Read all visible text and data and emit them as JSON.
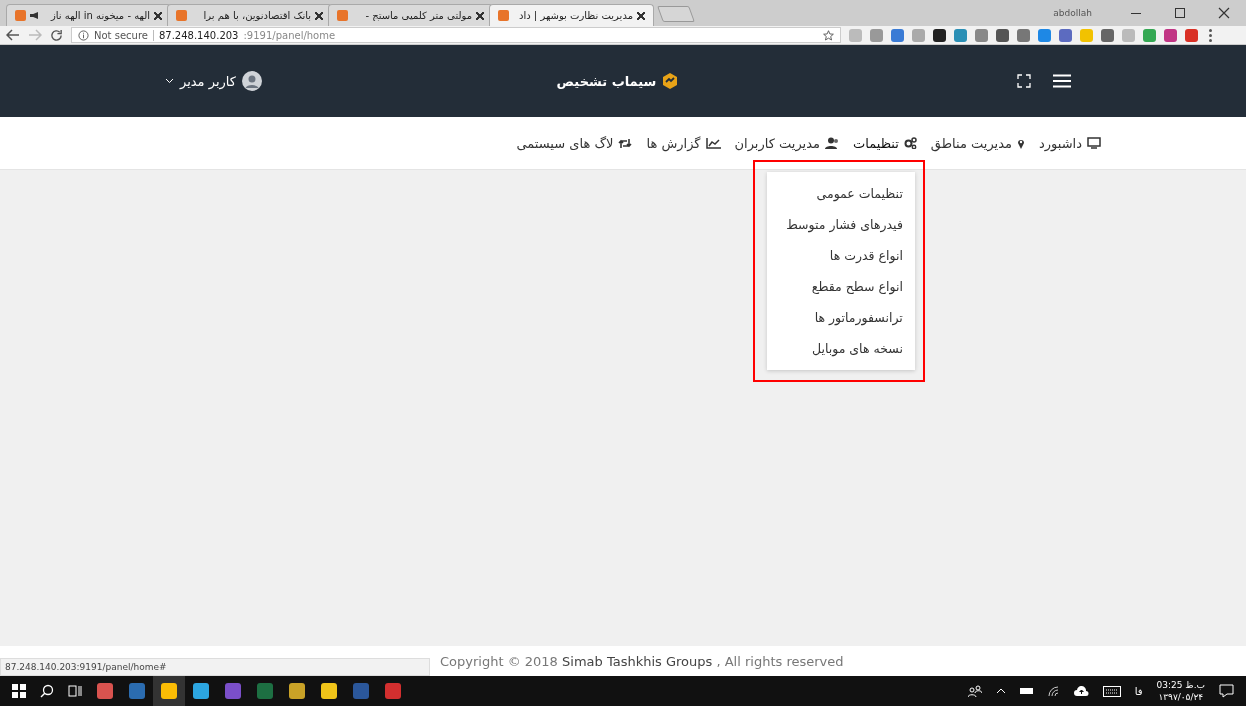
{
  "browser": {
    "tabs": [
      {
        "title": "مدیریت نظارت بوشهر | داد",
        "selected": true,
        "audio": false
      },
      {
        "title": "مولتی متر کلمپی ماستج -",
        "selected": false,
        "audio": false
      },
      {
        "title": "بانک اقتصادنوین، با هم برا",
        "selected": false,
        "audio": false
      },
      {
        "title": "الهه - میخونه in الهه ناز",
        "selected": false,
        "audio": true
      }
    ],
    "profile": "abdollah",
    "security": "Not secure",
    "url_host": "87.248.140.203",
    "url_rest": ":9191/panel/home"
  },
  "header": {
    "user": "کاربر مدیر",
    "brand": "سیماب تشخیص"
  },
  "nav": [
    {
      "label": "داشبورد",
      "kind": "monitor",
      "expanded": false
    },
    {
      "label": "مدیریت مناطق",
      "kind": "pin",
      "expanded": false
    },
    {
      "label": "تنظیمات",
      "kind": "gears",
      "expanded": true,
      "menu": [
        "تنظیمات عمومی",
        "فیدرهای فشار متوسط",
        "انواع قدرت ها",
        "انواع سطح مقطع",
        "ترانسفورماتور ها",
        "نسخه های موبایل"
      ]
    },
    {
      "label": "مدیریت کاربران",
      "kind": "user",
      "expanded": false
    },
    {
      "label": "گزارش ها",
      "kind": "chart",
      "expanded": false
    },
    {
      "label": "لاگ های سیستمی",
      "kind": "retweet",
      "expanded": false
    }
  ],
  "footer": {
    "copyright": "Copyright © 2018 **Simab Tashkhis Groups** , All rights reserved"
  },
  "status_url": "87.248.140.203:9191/panel/home#",
  "taskbar": {
    "language": "فا",
    "time": "03:25 ب.ظ",
    "date": "۱۳۹۷/۰۵/۲۴"
  }
}
